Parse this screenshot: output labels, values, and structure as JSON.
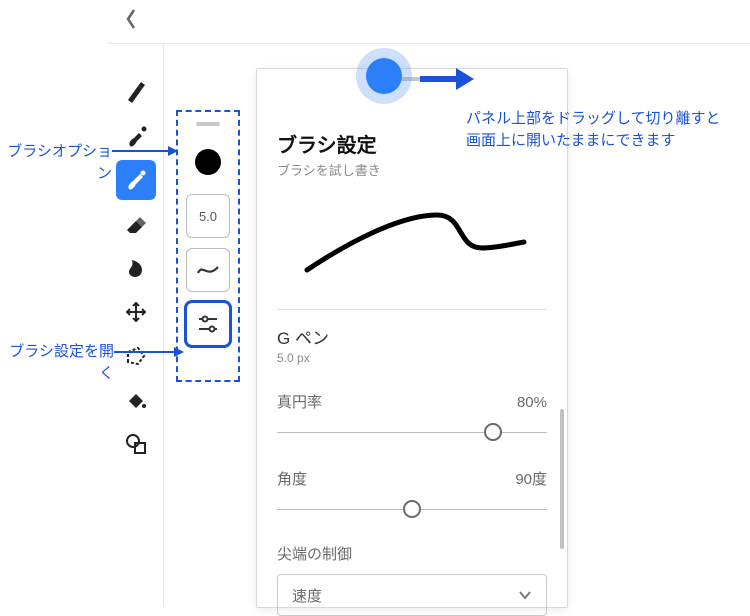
{
  "topbar": {
    "back_icon": "chevron-left"
  },
  "toolbar": {
    "tools": [
      {
        "name": "brush-marker",
        "selected": false
      },
      {
        "name": "paint-brush",
        "selected": false
      },
      {
        "name": "round-brush",
        "selected": true
      },
      {
        "name": "eraser",
        "selected": false
      },
      {
        "name": "smudge",
        "selected": false
      },
      {
        "name": "move",
        "selected": false
      },
      {
        "name": "lasso",
        "selected": false
      },
      {
        "name": "fill",
        "selected": false
      },
      {
        "name": "shape",
        "selected": false
      }
    ]
  },
  "brush_options": {
    "size_label": "5.0"
  },
  "panel": {
    "title": "ブラシ設定",
    "subtitle": "ブラシを試し書き",
    "brush_name": "G ペン",
    "brush_size": "5.0 px",
    "sliders": {
      "roundness": {
        "label": "真円率",
        "value": "80%",
        "pct": 80
      },
      "angle": {
        "label": "角度",
        "value": "90度",
        "pct": 50
      }
    },
    "tip_section_label": "尖端の制御",
    "dropdown_selected": "速度"
  },
  "annotations": {
    "brush_options": "ブラシオプション",
    "open_brush_settings": "ブラシ設定を開く",
    "drag_tip_line1": "パネル上部をドラッグして切り離すと",
    "drag_tip_line2": "画面上に開いたままにできます"
  }
}
